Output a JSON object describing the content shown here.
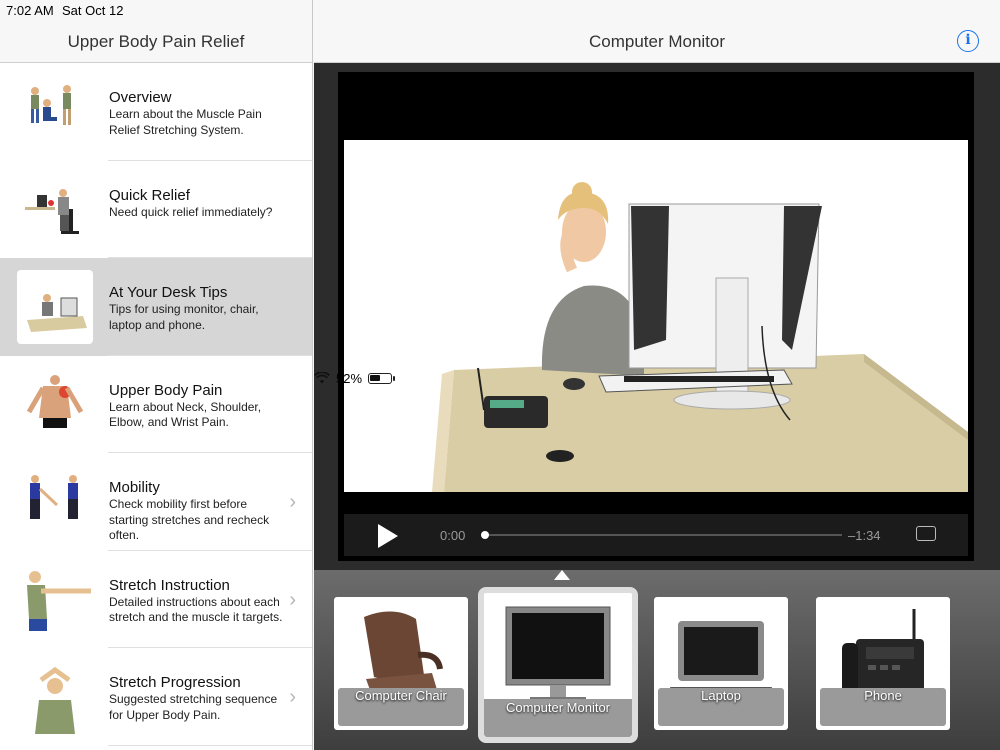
{
  "status": {
    "time": "7:02 AM",
    "date": "Sat Oct 12",
    "battery": "52%",
    "battery_level": 0.52
  },
  "sidebar": {
    "title": "Upper Body Pain Relief",
    "items": [
      {
        "title": "Overview",
        "desc": "Learn about the Muscle Pain Relief Stretching System.",
        "chevron": false,
        "icon": "overview-figures-icon"
      },
      {
        "title": "Quick Relief",
        "desc": "Need quick relief immediately?",
        "chevron": false,
        "icon": "desk-worker-icon"
      },
      {
        "title": "At Your Desk Tips",
        "desc": "Tips for using monitor, chair, laptop and phone.",
        "chevron": false,
        "selected": true,
        "icon": "desk-scene-icon"
      },
      {
        "title": "Upper Body Pain",
        "desc": "Learn about Neck, Shoulder, Elbow, and Wrist Pain.",
        "chevron": false,
        "icon": "back-muscles-icon"
      },
      {
        "title": "Mobility",
        "desc": "Check mobility first before starting stretches and recheck often.",
        "chevron": true,
        "icon": "mobility-figures-icon"
      },
      {
        "title": "Stretch Instruction",
        "desc": "Detailed instructions about each stretch and the muscle it targets.",
        "chevron": true,
        "icon": "arm-stretch-icon"
      },
      {
        "title": "Stretch Progression",
        "desc": "Suggested stretching sequence for Upper Body Pain.",
        "chevron": true,
        "icon": "neck-stretch-icon"
      }
    ]
  },
  "main": {
    "title": "Computer Monitor",
    "info_label": "i",
    "player": {
      "current": "0:00",
      "remaining": "–1:34",
      "progress": 0.0
    },
    "tiles": [
      {
        "label": "Computer Chair",
        "icon": "office-chair-icon"
      },
      {
        "label": "Computer Monitor",
        "icon": "monitor-icon",
        "selected": true
      },
      {
        "label": "Laptop",
        "icon": "laptop-icon"
      },
      {
        "label": "Phone",
        "icon": "desk-phone-icon"
      }
    ]
  },
  "colors": {
    "accent": "#1a73e8",
    "selected_row": "#d6d6d6"
  }
}
